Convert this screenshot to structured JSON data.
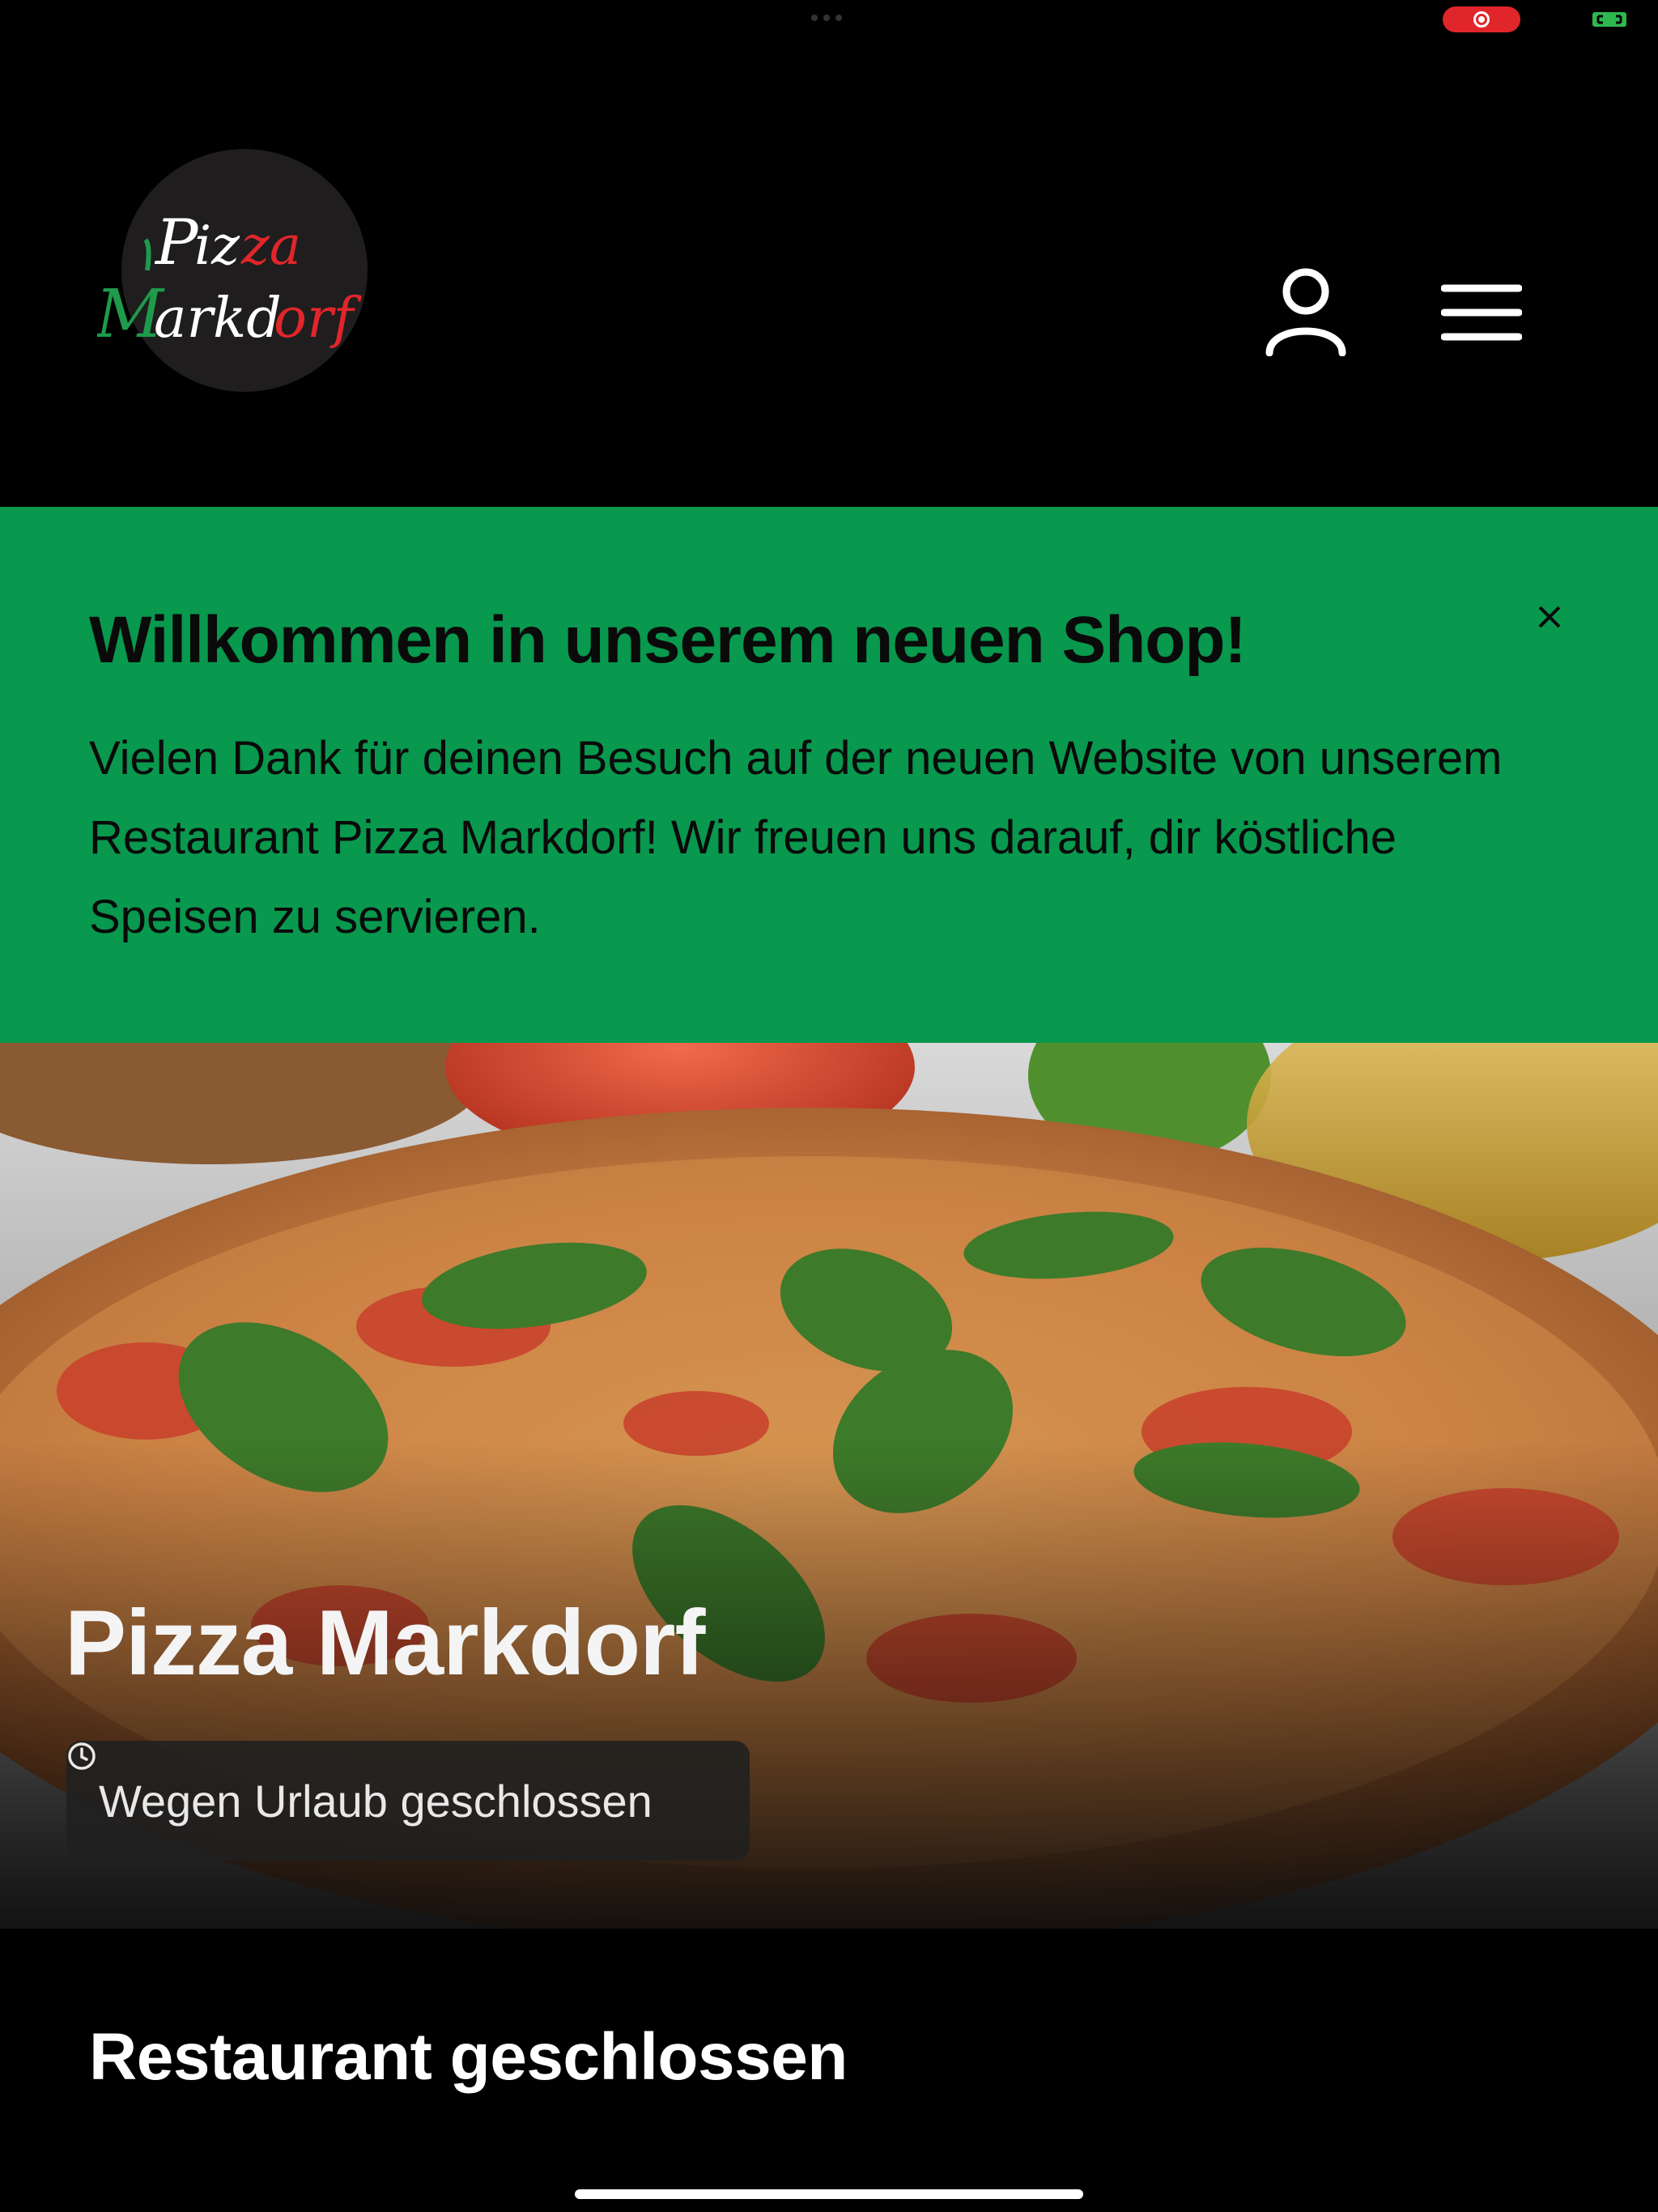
{
  "status_bar": {
    "recording_icon": "screen-record-icon",
    "cast_icon": "fullscreen-icon"
  },
  "header": {
    "logo": {
      "line1": "Pizza",
      "line2": "Markdorf",
      "colors": {
        "green": "#1e9a4b",
        "white": "#ffffff",
        "red": "#e0262b"
      }
    },
    "account_icon": "user-icon",
    "menu_icon": "hamburger-menu-icon"
  },
  "welcome_banner": {
    "title": "Willkommen in unserem neuen Shop!",
    "text": "Vielen Dank für deinen Besuch auf der neuen Website von unserem Restaurant Pizza Markdorf! Wir freuen uns darauf, dir köstliche Speisen zu servieren.",
    "close_icon": "close-icon",
    "background": "#08984e"
  },
  "hero": {
    "title": "Pizza Markdorf",
    "status_text": "Wegen Urlaub geschlossen",
    "status_icon": "clock-icon"
  },
  "main": {
    "section_title": "Restaurant geschlossen"
  }
}
